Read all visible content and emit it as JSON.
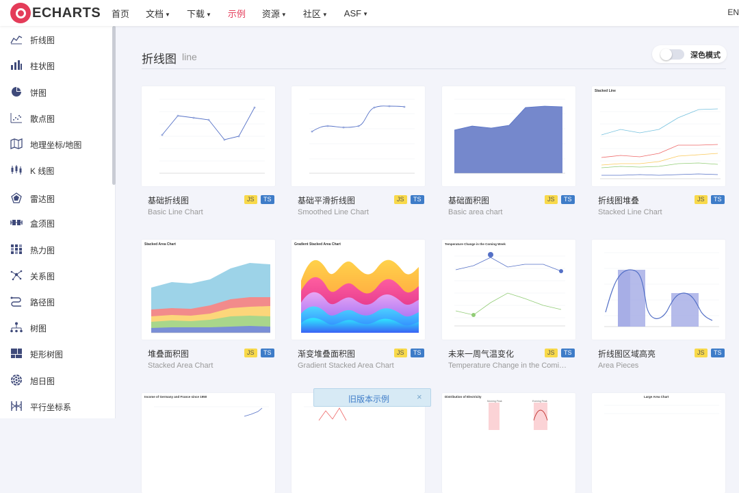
{
  "logo": {
    "text": "ECHARTS"
  },
  "nav": {
    "items": [
      {
        "label": "首页",
        "caret": false
      },
      {
        "label": "文档",
        "caret": true
      },
      {
        "label": "下载",
        "caret": true
      },
      {
        "label": "示例",
        "caret": false,
        "active": true
      },
      {
        "label": "资源",
        "caret": true
      },
      {
        "label": "社区",
        "caret": true
      },
      {
        "label": "ASF",
        "caret": true
      }
    ],
    "lang": "EN"
  },
  "sidebar": {
    "items": [
      {
        "label": "折线图",
        "icon": "line-chart-icon"
      },
      {
        "label": "柱状图",
        "icon": "bar-chart-icon"
      },
      {
        "label": "饼图",
        "icon": "pie-chart-icon"
      },
      {
        "label": "散点图",
        "icon": "scatter-icon"
      },
      {
        "label": "地理坐标/地图",
        "icon": "map-icon"
      },
      {
        "label": "K 线图",
        "icon": "candlestick-icon"
      },
      {
        "label": "雷达图",
        "icon": "radar-icon"
      },
      {
        "label": "盒须图",
        "icon": "boxplot-icon"
      },
      {
        "label": "热力图",
        "icon": "heatmap-icon"
      },
      {
        "label": "关系图",
        "icon": "graph-icon"
      },
      {
        "label": "路径图",
        "icon": "lines-icon"
      },
      {
        "label": "树图",
        "icon": "tree-icon"
      },
      {
        "label": "矩形树图",
        "icon": "treemap-icon"
      },
      {
        "label": "旭日图",
        "icon": "sunburst-icon"
      },
      {
        "label": "平行坐标系",
        "icon": "parallel-icon"
      }
    ]
  },
  "header": {
    "title": "折线图",
    "subtitle": "line",
    "dark_mode_label": "深色模式"
  },
  "cards": [
    {
      "title": "基础折线图",
      "subtitle": "Basic Line Chart",
      "js": "JS",
      "ts": "TS"
    },
    {
      "title": "基础平滑折线图",
      "subtitle": "Smoothed Line Chart",
      "js": "JS",
      "ts": "TS"
    },
    {
      "title": "基础面积图",
      "subtitle": "Basic area chart",
      "js": "JS",
      "ts": "TS"
    },
    {
      "title": "折线图堆叠",
      "subtitle": "Stacked Line Chart",
      "js": "JS",
      "ts": "TS"
    },
    {
      "title": "堆叠面积图",
      "subtitle": "Stacked Area Chart",
      "js": "JS",
      "ts": "TS"
    },
    {
      "title": "渐变堆叠面积图",
      "subtitle": "Gradient Stacked Area Chart",
      "js": "JS",
      "ts": "TS"
    },
    {
      "title": "未来一周气温变化",
      "subtitle": "Temperature Change in the Coming ...",
      "js": "JS",
      "ts": "TS"
    },
    {
      "title": "折线图区域高亮",
      "subtitle": "Area Pieces",
      "js": "JS",
      "ts": "TS"
    }
  ],
  "thumbs_text": {
    "t4_title": "Stacked Line",
    "t5_title": "Stacked Area Chart",
    "t6_title": "Gradient Stacked Area Chart",
    "t7_title": "Temperature Change in the Coming Week",
    "t9_title": "Income of Germany and France since 1950",
    "t11_title": "Distribution of Electricity",
    "t11_a": "Morning Peak",
    "t11_b": "Evening Peak",
    "t12_title": "Large Area Chart"
  },
  "banner": {
    "label": "旧版本示例",
    "close": "×"
  },
  "colors": {
    "accent": "#e43c59",
    "series": "#5470c6",
    "js_tag": "#f8d94a",
    "ts_tag": "#3e7cc8"
  }
}
